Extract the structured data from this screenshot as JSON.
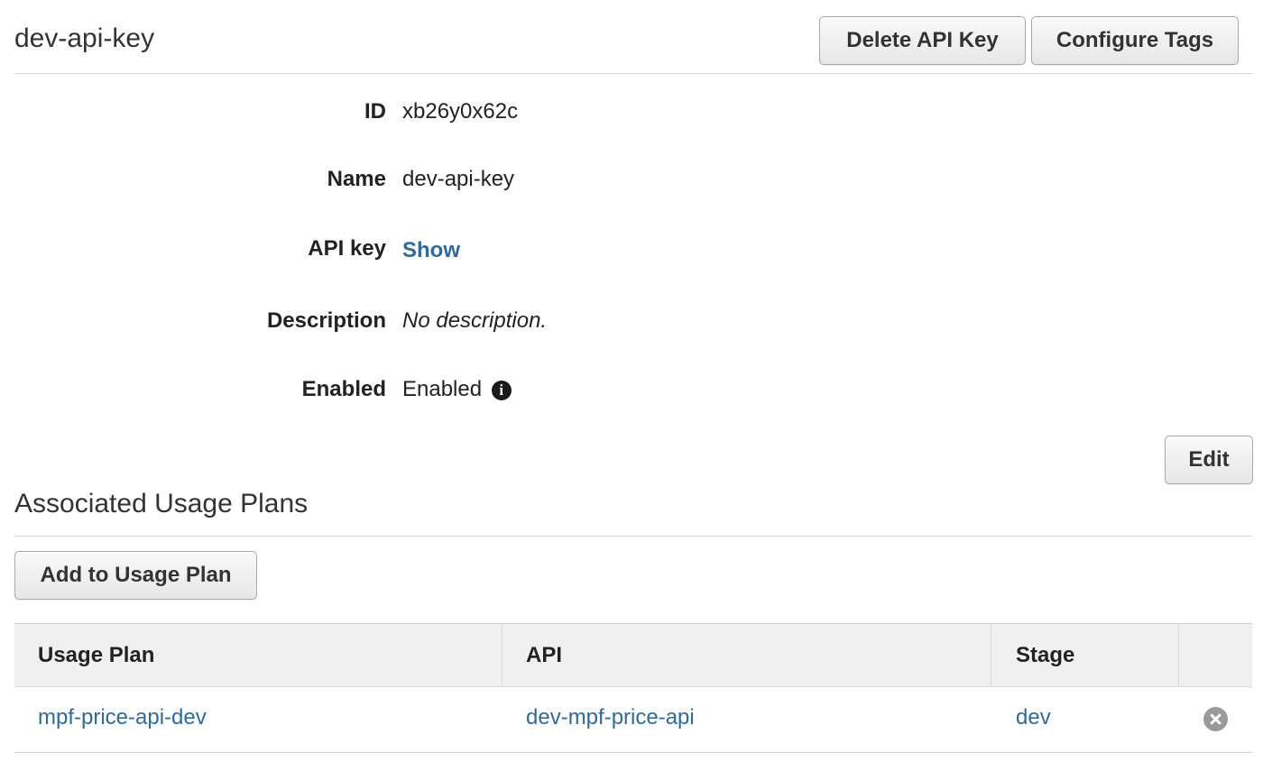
{
  "header": {
    "title": "dev-api-key",
    "delete_label": "Delete API Key",
    "configure_tags_label": "Configure Tags"
  },
  "details": {
    "id_label": "ID",
    "id_value": "xb26y0x62c",
    "name_label": "Name",
    "name_value": "dev-api-key",
    "api_key_label": "API key",
    "api_key_action": "Show",
    "description_label": "Description",
    "description_value": "No description.",
    "enabled_label": "Enabled",
    "enabled_value": "Enabled",
    "enabled_icon": "info-icon",
    "edit_label": "Edit"
  },
  "usage_plans": {
    "section_title": "Associated Usage Plans",
    "add_label": "Add to Usage Plan",
    "columns": [
      "Usage Plan",
      "API",
      "Stage",
      ""
    ],
    "rows": [
      {
        "plan": "mpf-price-api-dev",
        "api": "dev-mpf-price-api",
        "stage": "dev",
        "action_icon": "remove-icon"
      }
    ]
  },
  "colors": {
    "link": "#2e6a9e",
    "header_bg": "#f0f0f0",
    "remove_icon": "#9a9a9a"
  }
}
